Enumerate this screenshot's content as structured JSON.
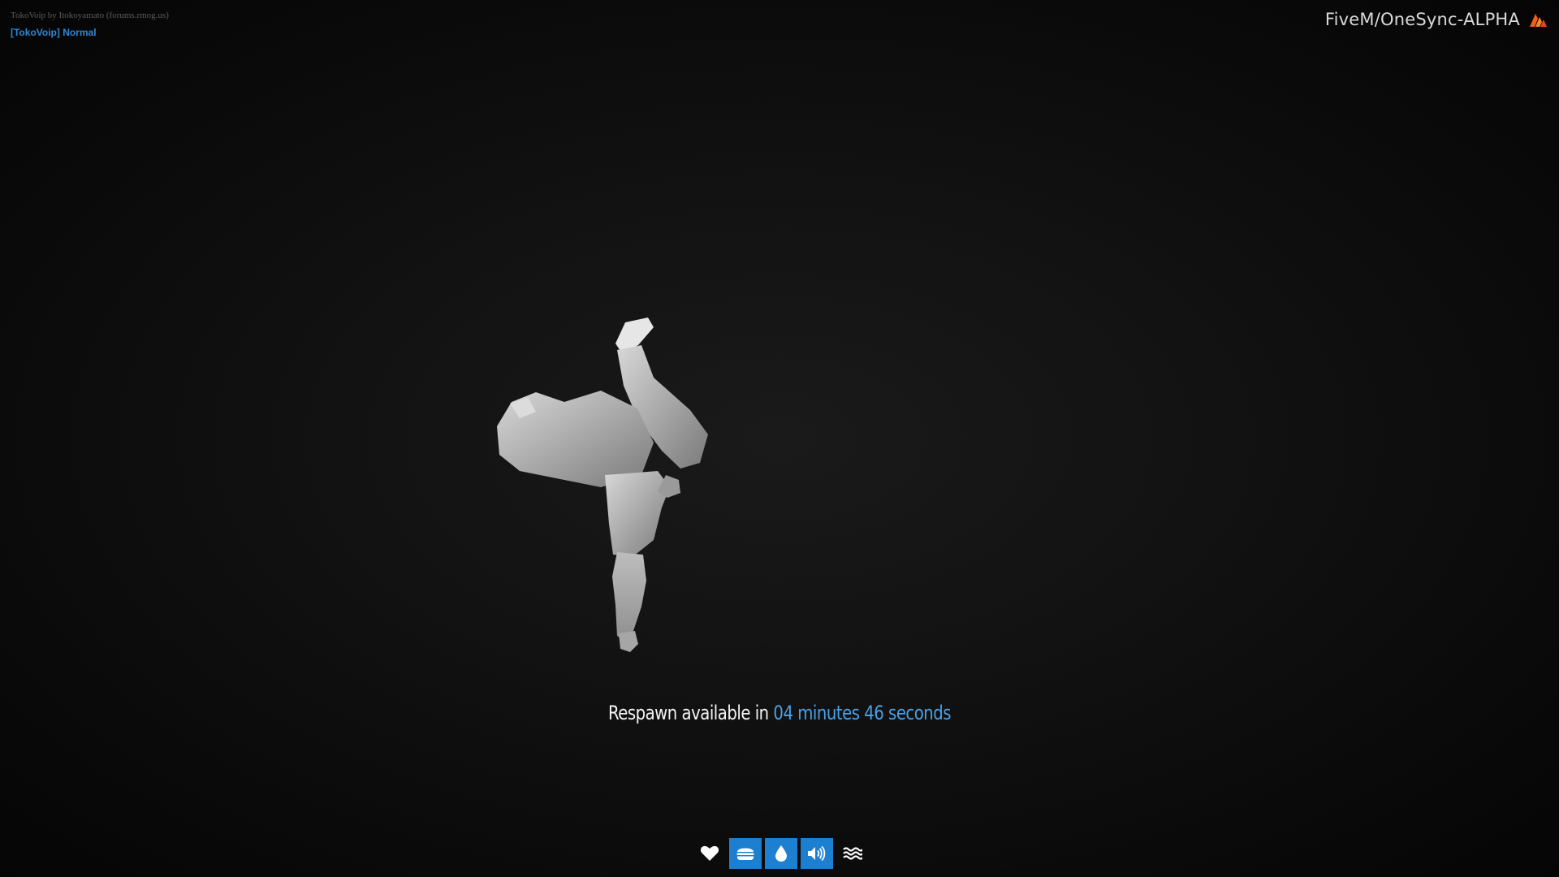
{
  "voip": {
    "credit": "TokoVoip by Itokoyamato (forums.rmog.us)",
    "mode": "[TokoVoip] Normal"
  },
  "brand": {
    "title": "FiveM/OneSync-ALPHA",
    "logo_icon": "fivem-logo-icon"
  },
  "respawn": {
    "prefix": "Respawn available in",
    "timer": "04 minutes 46 seconds"
  },
  "status_bar": {
    "items": [
      {
        "icon": "heart-icon",
        "active": false
      },
      {
        "icon": "hamburger-icon",
        "active": true
      },
      {
        "icon": "water-drop-icon",
        "active": true
      },
      {
        "icon": "speaker-icon",
        "active": true
      },
      {
        "icon": "waves-icon",
        "active": false
      }
    ]
  },
  "colors": {
    "accent": "#1d7fd0",
    "timer": "#4aa0e6",
    "voip_mode": "#2f86d4"
  }
}
